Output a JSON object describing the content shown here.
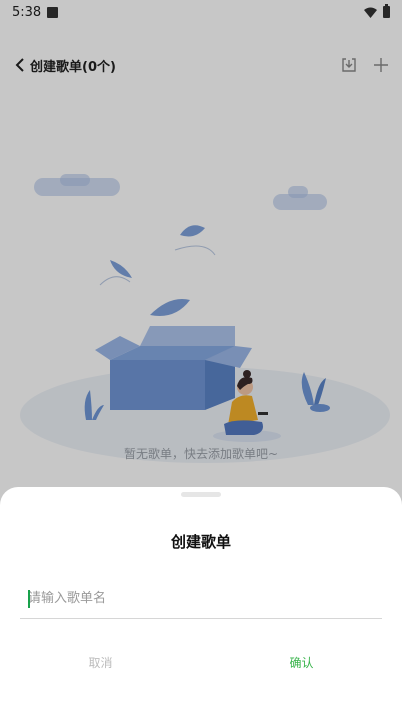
{
  "status_bar": {
    "time": "5:38"
  },
  "header": {
    "title": "创建歌单(0个)"
  },
  "empty_state": {
    "text": "暂无歌单，快去添加歌单吧~"
  },
  "dialog": {
    "title": "创建歌单",
    "input_placeholder": "请输入歌单名",
    "input_value": "",
    "cancel_label": "取消",
    "confirm_label": "确认"
  },
  "colors": {
    "accent": "#37b34a",
    "illustration_blue": "#6f97d6"
  },
  "icons": [
    "back-icon",
    "import-icon",
    "plus-icon",
    "wifi-icon",
    "battery-icon"
  ]
}
